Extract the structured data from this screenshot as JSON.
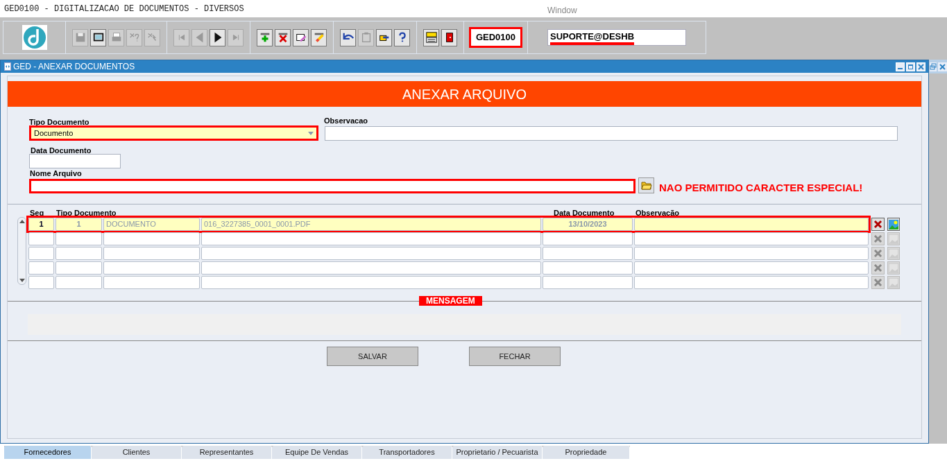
{
  "app_title": "GED0100 - DIGITALIZACAO DE DOCUMENTOS - DIVERSOS",
  "menu": "Window",
  "toolbar": {
    "groups": [
      [
        {
          "kind": "save",
          "disabled": true
        },
        {
          "kind": "screen",
          "disabled": false
        },
        {
          "kind": "print",
          "disabled": true
        },
        {
          "kind": "query",
          "disabled": true
        },
        {
          "kind": "execute",
          "disabled": true
        }
      ],
      [
        {
          "kind": "first",
          "disabled": true
        },
        {
          "kind": "prev",
          "disabled": true
        },
        {
          "kind": "next",
          "disabled": false
        },
        {
          "kind": "last",
          "disabled": true
        }
      ],
      [
        {
          "kind": "add",
          "disabled": false
        },
        {
          "kind": "delete",
          "disabled": false
        },
        {
          "kind": "edit",
          "disabled": false
        },
        {
          "kind": "clear",
          "disabled": false
        }
      ],
      [
        {
          "kind": "undo",
          "disabled": false
        },
        {
          "kind": "clipboard",
          "disabled": true
        },
        {
          "kind": "pointer",
          "disabled": false
        },
        {
          "kind": "help",
          "disabled": false
        }
      ],
      [
        {
          "kind": "menu",
          "disabled": false
        },
        {
          "kind": "exit",
          "disabled": false
        }
      ]
    ],
    "form_code": "GED0100",
    "user": "SUPORTE@DESHB"
  },
  "window": {
    "title": "GED - ANEXAR DOCUMENTOS"
  },
  "header": "ANEXAR ARQUIVO",
  "fields": {
    "tipo_documento": {
      "label": "Tipo Documento",
      "value": "Documento",
      "highlighted": true
    },
    "observacao": {
      "label": "Observacao",
      "highlighted": false
    },
    "data_documento": {
      "label": "Data Documento",
      "highlighted": false
    },
    "nome_arquivo": {
      "label": "Nome Arquivo",
      "highlighted": true
    },
    "warning": "NAO PERMITIDO CARACTER ESPECIAL!"
  },
  "table": {
    "columns": [
      "Seq",
      "Tipo Documento",
      "Data Documento",
      "Observação"
    ],
    "rows": [
      {
        "selected": true,
        "seq": "1",
        "tipo": "1",
        "descricao": "DOCUMENTO",
        "arquivo": "016_3227385_0001_0001.PDF",
        "data": "13/10/2023",
        "actions_enabled": true
      },
      {
        "selected": false,
        "actions_enabled": false
      },
      {
        "selected": false,
        "actions_enabled": false
      },
      {
        "selected": false,
        "actions_enabled": false
      },
      {
        "selected": false,
        "actions_enabled": false
      }
    ]
  },
  "message": {
    "label": "MENSAGEM"
  },
  "buttons": [
    "SALVAR",
    "FECHAR"
  ],
  "tabs": [
    {
      "label": "Fornecedores",
      "selected": true
    },
    {
      "label": "Clientes",
      "selected": false
    },
    {
      "label": "Representantes",
      "selected": false
    },
    {
      "label": "Equipe De Vendas",
      "selected": false
    },
    {
      "label": "Transportadores",
      "selected": false
    },
    {
      "label": "Proprietario / Pecuarista",
      "selected": false
    },
    {
      "label": "Propriedade",
      "selected": false
    }
  ]
}
